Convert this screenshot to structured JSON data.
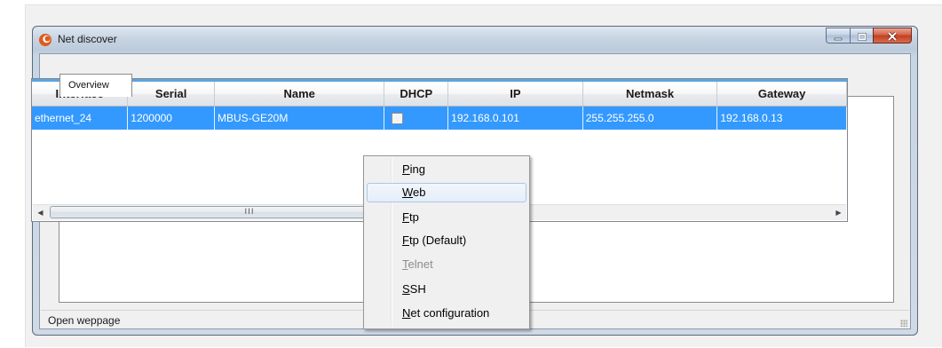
{
  "window": {
    "title": "Net discover"
  },
  "tabs": [
    {
      "label": "Overview",
      "active": true
    }
  ],
  "table": {
    "columns": [
      {
        "label": "Interface"
      },
      {
        "label": "Serial"
      },
      {
        "label": "Name"
      },
      {
        "label": "DHCP"
      },
      {
        "label": "IP"
      },
      {
        "label": "Netmask"
      },
      {
        "label": "Gateway"
      }
    ],
    "rows": [
      {
        "interface": "ethernet_24",
        "serial": "1200000",
        "name": "MBUS-GE20M",
        "dhcp": false,
        "ip": "192.168.0.101",
        "netmask": "255.255.255.0",
        "gateway": "192.168.0.13",
        "selected": true
      }
    ],
    "scrollbar_thumb_grip": "III"
  },
  "status": {
    "text": "Open weppage"
  },
  "context_menu": {
    "items": [
      {
        "mnemonic": "P",
        "rest": "ing",
        "enabled": true,
        "hovered": false
      },
      {
        "mnemonic": "W",
        "rest": "eb",
        "enabled": true,
        "hovered": true
      },
      {
        "mnemonic": "F",
        "rest": "tp",
        "enabled": true,
        "hovered": false
      },
      {
        "mnemonic": "F",
        "rest": "tp (Default)",
        "enabled": true,
        "hovered": false
      },
      {
        "mnemonic": "T",
        "rest": "elnet",
        "enabled": false,
        "hovered": false
      },
      {
        "mnemonic": "S",
        "rest": "SH",
        "enabled": true,
        "hovered": false
      },
      {
        "mnemonic": "N",
        "rest": "et configuration",
        "enabled": true,
        "hovered": false
      }
    ]
  },
  "colors": {
    "selection": "#3399ff",
    "header_accent": "#5ba5e0",
    "close_button": "#c1401f"
  },
  "icons": {
    "app": "app-logo-icon",
    "minimize": "minimize-icon",
    "maximize": "maximize-icon",
    "close": "close-icon",
    "scroll_left": "arrow-left-icon",
    "scroll_right": "arrow-right-icon"
  }
}
